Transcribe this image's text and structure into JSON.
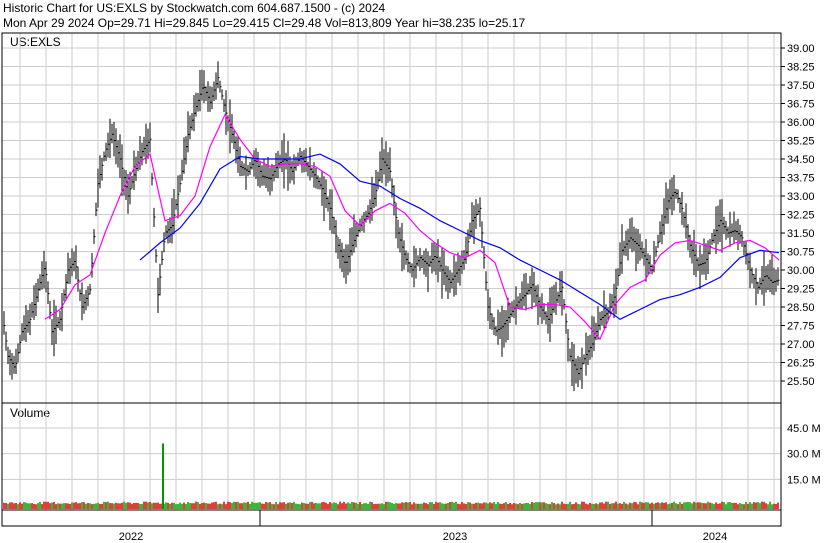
{
  "header": {
    "title": "Historic Chart for US:EXLS by Stockwatch.com 604.687.1500 - (c) 2024",
    "quote": "Mon Apr 29 2024   Op=29.71   Hi=29.845   Lo=29.415   Cl=29.48   Vol=813,809   Year hi=38.235   lo=25.17"
  },
  "chart_data": [
    {
      "type": "line",
      "label": "US:EXLS",
      "y_ticks": [
        "39.00",
        "38.25",
        "37.50",
        "36.75",
        "36.00",
        "35.25",
        "34.50",
        "33.75",
        "33.00",
        "32.25",
        "31.50",
        "30.75",
        "30.00",
        "29.25",
        "28.50",
        "27.75",
        "27.00",
        "26.25",
        "25.50"
      ],
      "ylim": [
        24.9,
        39.5
      ],
      "x_labels": [
        "2022",
        "2023",
        "2024"
      ],
      "colors": {
        "price": "#000000",
        "ma_short": "#ff00ff",
        "ma_long": "#0000ff"
      },
      "series": [
        {
          "key": "price",
          "x": [
            0,
            8,
            15,
            22,
            30,
            38,
            45,
            52,
            60,
            68,
            75,
            82,
            90,
            98,
            105,
            112,
            120,
            128,
            135,
            142,
            150,
            158,
            165,
            172,
            180,
            188,
            195,
            203,
            210,
            218,
            225,
            232,
            240,
            248,
            255,
            262,
            270,
            278,
            285,
            292,
            300,
            308,
            315,
            322,
            330,
            338,
            345,
            352,
            360,
            368,
            375,
            382,
            390,
            398,
            405,
            412,
            420,
            428,
            435,
            442,
            450,
            458,
            465,
            472,
            480,
            488,
            495,
            502,
            510,
            518,
            525,
            532,
            540,
            548,
            555,
            562,
            570,
            578,
            585,
            592,
            600,
            608,
            615,
            622,
            630,
            638,
            645,
            652,
            660,
            668,
            675,
            682,
            690,
            698,
            705,
            712,
            720,
            728,
            735,
            742,
            750,
            758,
            765,
            772,
            779
          ],
          "y": [
            29.0,
            26.5,
            26.0,
            27.5,
            28.0,
            29.2,
            30.2,
            27.5,
            28.0,
            30.0,
            30.4,
            28.5,
            29.2,
            33.5,
            34.8,
            35.5,
            34.5,
            33.0,
            34.0,
            34.8,
            35.3,
            29.0,
            31.5,
            31.8,
            33.5,
            35.5,
            36.5,
            37.5,
            36.8,
            37.8,
            36.5,
            35.5,
            34.2,
            34.0,
            34.5,
            33.8,
            33.7,
            34.3,
            34.5,
            34.0,
            34.6,
            34.2,
            33.8,
            33.3,
            32.5,
            31.0,
            30.2,
            31.0,
            31.8,
            32.3,
            33.0,
            34.5,
            34.0,
            31.5,
            30.5,
            30.0,
            30.5,
            30.2,
            30.6,
            30.0,
            29.5,
            30.0,
            30.5,
            32.0,
            32.5,
            28.5,
            27.5,
            27.7,
            28.2,
            28.7,
            29.0,
            29.4,
            28.5,
            28.0,
            28.7,
            29.3,
            26.5,
            25.8,
            26.5,
            27.0,
            28.0,
            28.3,
            29.0,
            30.8,
            31.3,
            31.0,
            30.5,
            30.0,
            31.5,
            32.8,
            33.2,
            32.5,
            31.0,
            30.2,
            30.3,
            31.2,
            32.0,
            31.5,
            31.6,
            31.3,
            30.0,
            29.3,
            29.8,
            29.5,
            29.6
          ]
        },
        {
          "key": "ma_short",
          "x": [
            45,
            60,
            75,
            90,
            105,
            120,
            135,
            150,
            165,
            180,
            195,
            210,
            225,
            240,
            255,
            270,
            285,
            300,
            315,
            330,
            345,
            360,
            375,
            390,
            405,
            420,
            435,
            450,
            465,
            480,
            495,
            510,
            525,
            540,
            555,
            570,
            585,
            600,
            615,
            630,
            645,
            660,
            675,
            690,
            705,
            720,
            735,
            750,
            765,
            779
          ],
          "y": [
            28.0,
            28.4,
            29.4,
            29.8,
            31.5,
            33.0,
            34.2,
            34.7,
            32.0,
            32.2,
            33.0,
            35.0,
            36.3,
            35.3,
            34.5,
            34.2,
            34.3,
            34.3,
            34.2,
            33.8,
            32.4,
            31.8,
            32.4,
            32.7,
            32.3,
            31.6,
            31.1,
            30.7,
            30.5,
            30.8,
            30.3,
            28.5,
            28.4,
            28.6,
            28.6,
            28.5,
            27.9,
            27.2,
            28.6,
            29.3,
            29.6,
            30.6,
            31.1,
            31.2,
            31.0,
            30.8,
            31.1,
            31.2,
            30.9,
            30.4
          ]
        },
        {
          "key": "ma_long",
          "x": [
            140,
            160,
            180,
            200,
            220,
            240,
            260,
            280,
            300,
            320,
            340,
            360,
            380,
            400,
            420,
            440,
            460,
            480,
            500,
            520,
            540,
            560,
            580,
            600,
            620,
            640,
            660,
            680,
            700,
            720,
            740,
            760,
            779
          ],
          "y": [
            30.4,
            31.1,
            31.7,
            32.7,
            34.1,
            34.6,
            34.5,
            34.5,
            34.5,
            34.7,
            34.3,
            33.6,
            33.4,
            32.9,
            32.5,
            32.0,
            31.6,
            31.2,
            30.9,
            30.4,
            30.0,
            29.6,
            29.1,
            28.6,
            28.0,
            28.4,
            28.8,
            29.0,
            29.3,
            29.7,
            30.5,
            30.8,
            30.7
          ]
        }
      ]
    },
    {
      "type": "bar",
      "label": "Volume",
      "y_ticks": [
        "45.0 M",
        "30.0 M",
        "15.0 M"
      ],
      "ylim": [
        0,
        50
      ],
      "spike": {
        "x": 163,
        "value": 36
      },
      "base_colors": [
        "#cc0000",
        "#009900"
      ]
    }
  ]
}
